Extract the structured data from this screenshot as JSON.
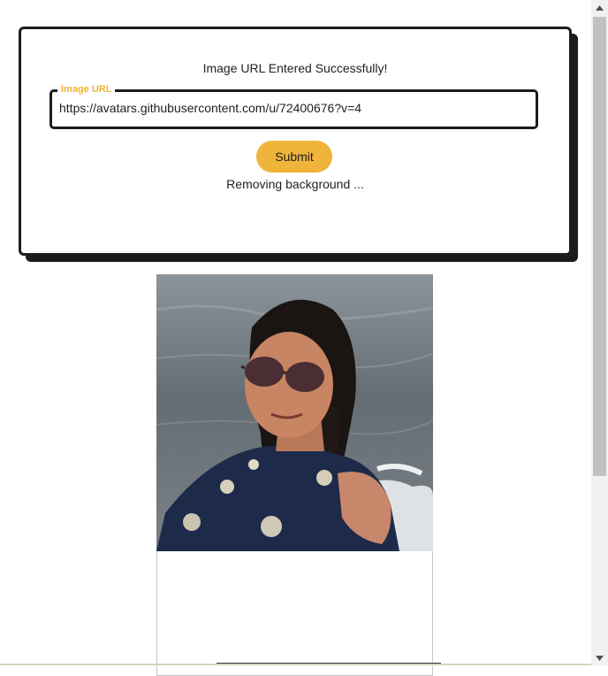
{
  "form": {
    "status_message": "Image URL Entered Successfully!",
    "url_field_label": "Image URL",
    "url_value": "https://avatars.githubusercontent.com/u/72400676?v=4",
    "submit_label": "Submit",
    "progress_message": "Removing background ..."
  },
  "colors": {
    "accent": "#f0b43b",
    "border": "#1c1c1c"
  },
  "icons": {
    "scroll_up": "chevron-up-icon",
    "scroll_down": "chevron-down-icon"
  }
}
